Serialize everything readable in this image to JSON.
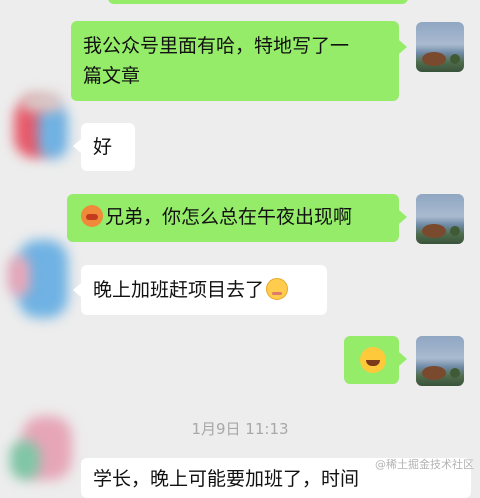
{
  "chat": {
    "messages": [
      {
        "side": "outgoing",
        "lines": [
          "我公众号里面有哈，特地写了一",
          "篇文章"
        ]
      },
      {
        "side": "incoming",
        "text": "好"
      },
      {
        "side": "outgoing",
        "emoji": "hot-face-icon",
        "text": "兄弟，你怎么总在午夜出现啊"
      },
      {
        "side": "incoming",
        "text": "晚上加班赶项目去了",
        "emoji": "shy-smile-icon"
      },
      {
        "side": "outgoing",
        "emoji": "tears-of-joy-icon"
      }
    ],
    "timestamp": "1月9日 11:13",
    "partial_message": "学长，晚上可能要加班了，时间"
  },
  "watermark": "@稀土掘金技术社区",
  "colors": {
    "background": "#ededed",
    "outgoing_bubble": "#95ec69",
    "incoming_bubble": "#ffffff",
    "timestamp_text": "#a8a8a8"
  }
}
